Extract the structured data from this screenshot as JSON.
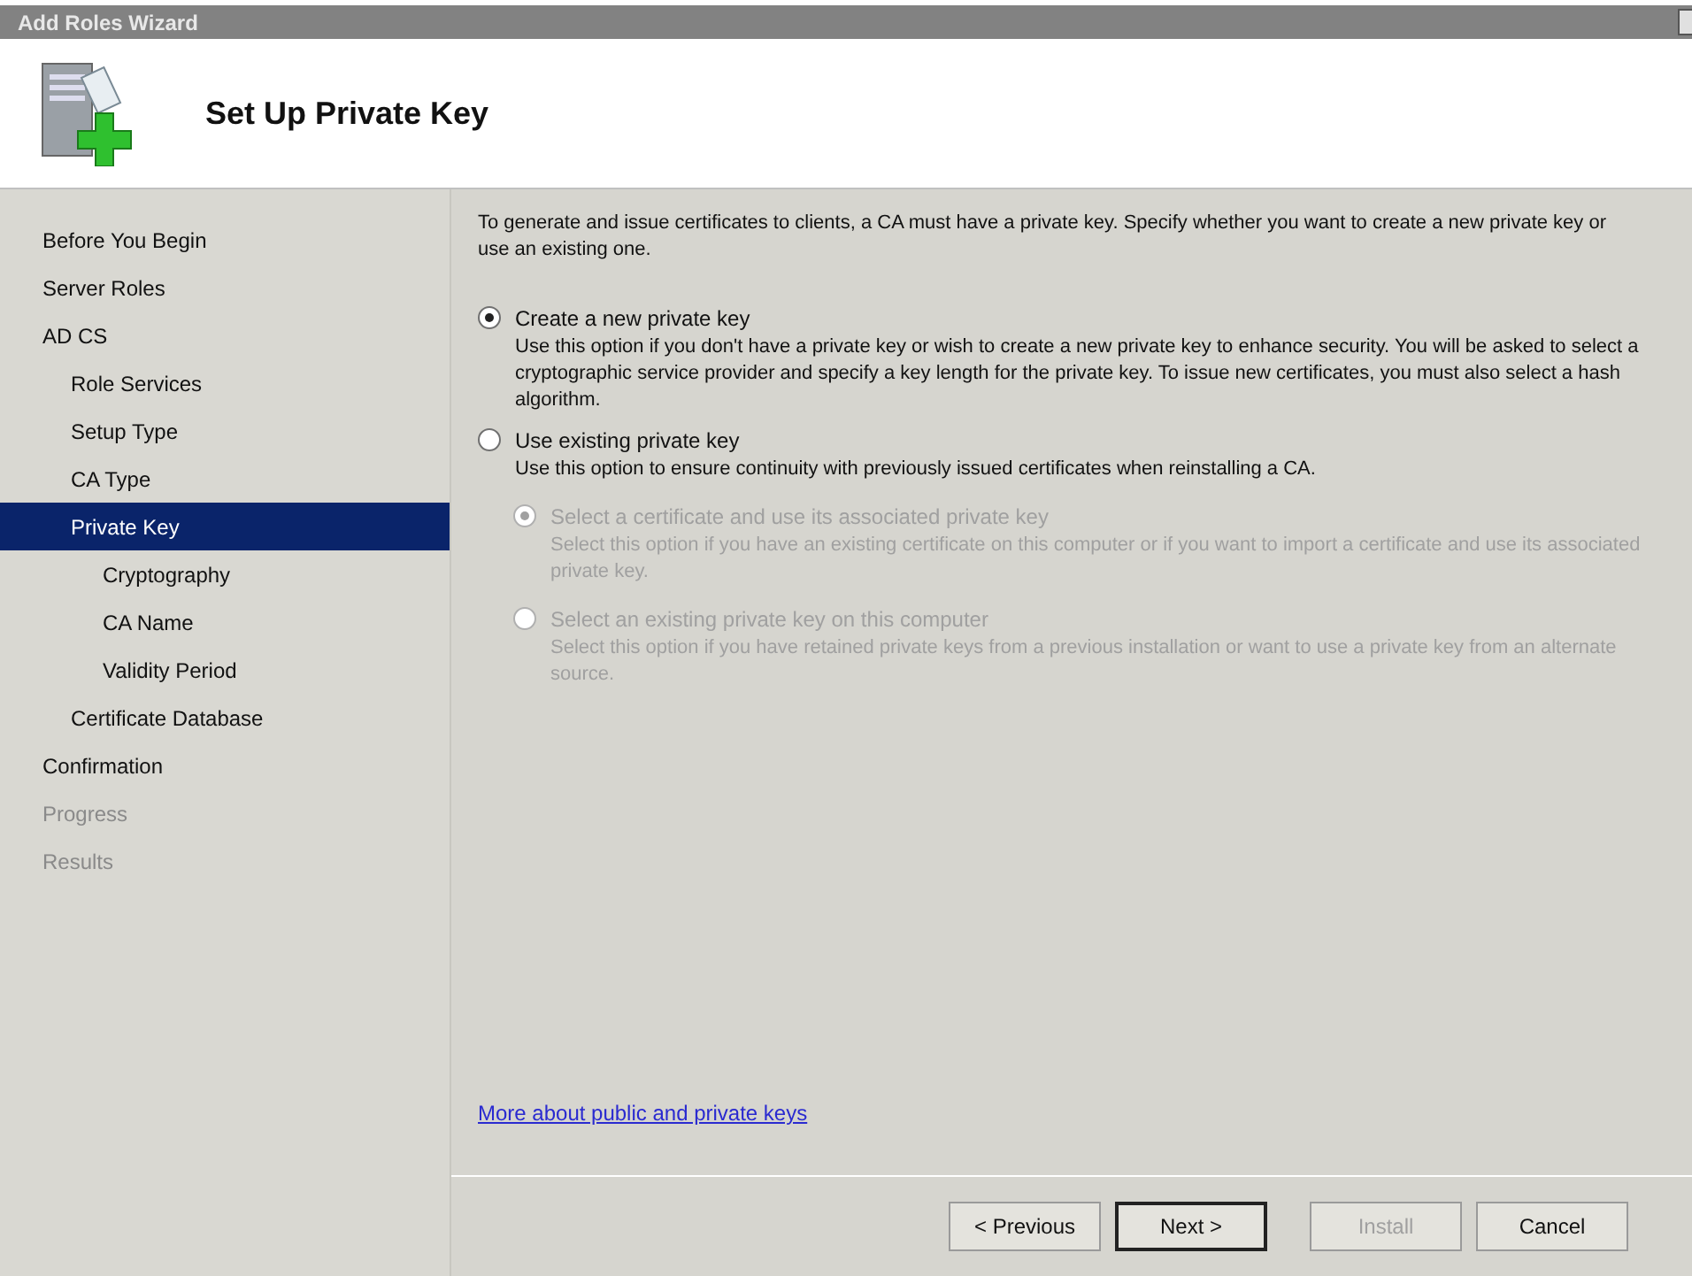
{
  "window": {
    "title": "Add Roles Wizard"
  },
  "header": {
    "title": "Set Up Private Key"
  },
  "sidebar": {
    "items": [
      {
        "label": "Before You Begin",
        "selected": false,
        "disabled": false
      },
      {
        "label": "Server Roles",
        "selected": false,
        "disabled": false
      },
      {
        "label": "AD CS",
        "selected": false,
        "disabled": false,
        "children": [
          {
            "label": "Role Services",
            "selected": false,
            "disabled": false
          },
          {
            "label": "Setup Type",
            "selected": false,
            "disabled": false
          },
          {
            "label": "CA Type",
            "selected": false,
            "disabled": false
          },
          {
            "label": "Private Key",
            "selected": true,
            "disabled": false,
            "children": [
              {
                "label": "Cryptography",
                "selected": false,
                "disabled": false
              },
              {
                "label": "CA Name",
                "selected": false,
                "disabled": false
              },
              {
                "label": "Validity Period",
                "selected": false,
                "disabled": false
              }
            ]
          },
          {
            "label": "Certificate Database",
            "selected": false,
            "disabled": false
          }
        ]
      },
      {
        "label": "Confirmation",
        "selected": false,
        "disabled": false
      },
      {
        "label": "Progress",
        "selected": false,
        "disabled": true
      },
      {
        "label": "Results",
        "selected": false,
        "disabled": true
      }
    ]
  },
  "content": {
    "intro": "To generate and issue certificates to clients, a CA must have a private key. Specify whether you want to create a new private key or use an existing one.",
    "options": [
      {
        "label": "Create a new private key",
        "selected": true,
        "disabled": false,
        "description": "Use this option if you don't have a private key or wish to create a new private key to enhance security. You will be asked to select a cryptographic service provider and specify a key length for the private key. To issue new certificates, you must also select a hash algorithm."
      },
      {
        "label": "Use existing private key",
        "selected": false,
        "disabled": false,
        "description": "Use this option to ensure continuity with previously issued certificates when reinstalling a CA.",
        "children": [
          {
            "label": "Select a certificate and use its associated private key",
            "selected": true,
            "disabled": true,
            "description": "Select this option if you have an existing certificate on this computer or if you want to import a certificate and use its associated private key."
          },
          {
            "label": "Select an existing private key on this computer",
            "selected": false,
            "disabled": true,
            "description": "Select this option if you have retained private keys from a previous installation or want to use a private key from an alternate source."
          }
        ]
      }
    ],
    "link": "More about public and private keys"
  },
  "buttons": [
    {
      "label": "< Previous",
      "disabled": false,
      "default": false
    },
    {
      "label": "Next >",
      "disabled": false,
      "default": true
    },
    {
      "label": "Install",
      "disabled": true,
      "default": false
    },
    {
      "label": "Cancel",
      "disabled": false,
      "default": false
    }
  ]
}
